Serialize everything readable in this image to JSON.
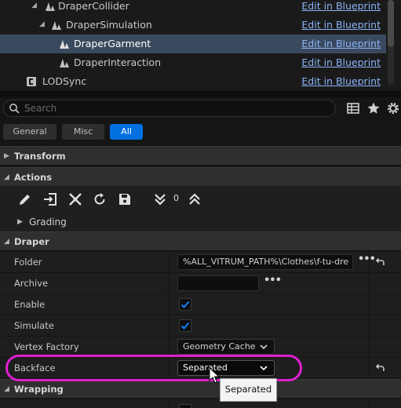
{
  "tree": {
    "rows": [
      {
        "label": "DraperCollider",
        "link": "Edit in Blueprint"
      },
      {
        "label": "DraperSimulation",
        "link": "Edit in Blueprint"
      },
      {
        "label": "DraperGarment",
        "link": "Edit in Blueprint"
      },
      {
        "label": "DraperInteraction",
        "link": "Edit in Blueprint"
      },
      {
        "label": "LODSync",
        "link": "Edit in Blueprint"
      }
    ],
    "selected": "DraperGarment"
  },
  "search": {
    "placeholder": "Search"
  },
  "filters": {
    "general": "General",
    "misc": "Misc",
    "all": "All",
    "active": "All"
  },
  "sections": {
    "transform": "Transform",
    "actions": "Actions",
    "draper": "Draper",
    "wrapping": "Wrapping"
  },
  "actions": {
    "count": "0",
    "grading": "Grading"
  },
  "properties": {
    "folder": {
      "label": "Folder",
      "value": "%ALL_VITRUM_PATH%\\Clothes\\f-tu-dre"
    },
    "archive": {
      "label": "Archive",
      "value": ""
    },
    "enable": {
      "label": "Enable",
      "checked": true
    },
    "simulate": {
      "label": "Simulate",
      "checked": true
    },
    "vertex_factory": {
      "label": "Vertex Factory",
      "value": "Geometry Cache"
    },
    "backface": {
      "label": "Backface",
      "value": "Separated"
    }
  },
  "tooltip": {
    "text": "Separated"
  },
  "colors": {
    "accent": "#0070e0",
    "link": "#8ab4f8",
    "highlight": "#e020d0",
    "selected_row": "#3a4a5e"
  }
}
